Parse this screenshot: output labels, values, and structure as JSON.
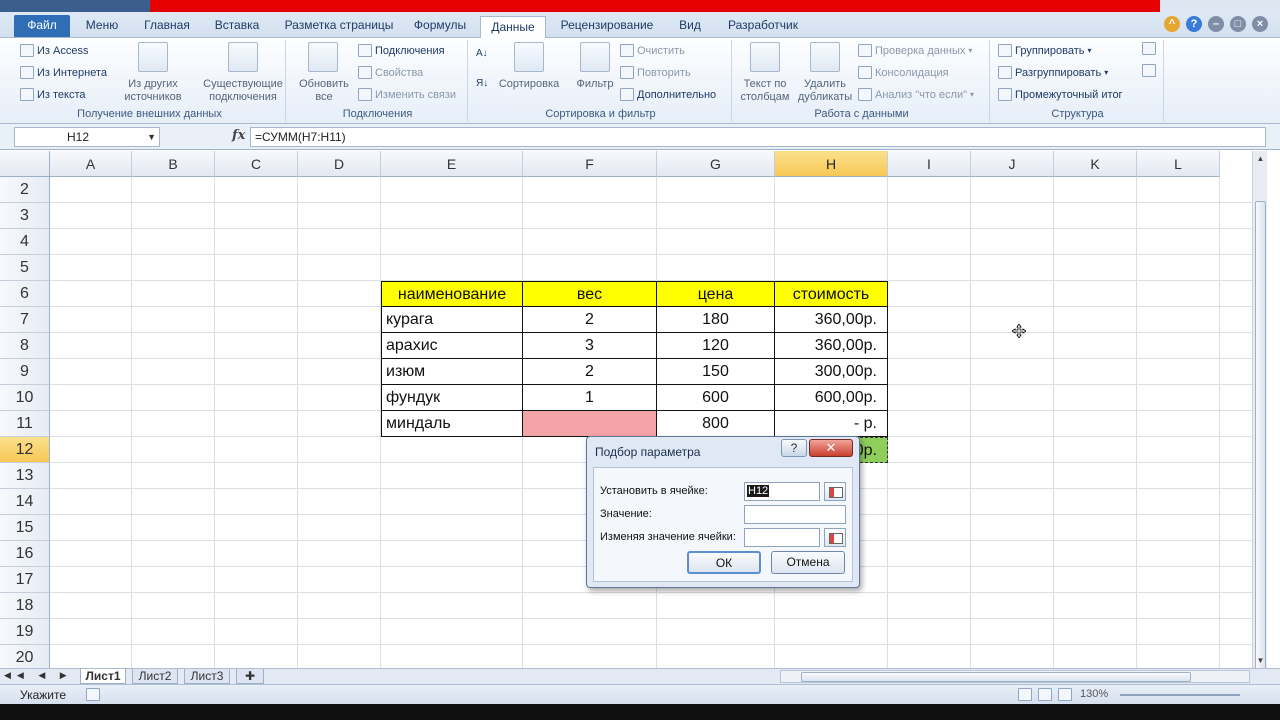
{
  "ribbon_tabs": [
    {
      "label": "Файл"
    },
    {
      "label": "Меню"
    },
    {
      "label": "Главная"
    },
    {
      "label": "Вставка"
    },
    {
      "label": "Разметка страницы"
    },
    {
      "label": "Формулы"
    },
    {
      "label": "Данные"
    },
    {
      "label": "Рецензирование"
    },
    {
      "label": "Вид"
    },
    {
      "label": "Разработчик"
    }
  ],
  "ribbon": {
    "external": {
      "from_access": "Из Access",
      "from_web": "Из Интернета",
      "from_text": "Из текста",
      "from_other_line1": "Из других",
      "from_other_line2": "источников",
      "existing_line1": "Существующие",
      "existing_line2": "подключения",
      "label": "Получение внешних данных"
    },
    "connections": {
      "refresh_line1": "Обновить",
      "refresh_line2": "все",
      "connections": "Подключения",
      "properties": "Свойства",
      "edit_links": "Изменить связи",
      "label": "Подключения"
    },
    "sort_filter": {
      "sort": "Сортировка",
      "filter": "Фильтр",
      "clear": "Очистить",
      "reapply": "Повторить",
      "advanced": "Дополнительно",
      "label": "Сортировка и фильтр"
    },
    "data_tools": {
      "text_to_cols_line1": "Текст по",
      "text_to_cols_line2": "столбцам",
      "remove_dups_line1": "Удалить",
      "remove_dups_line2": "дубликаты",
      "validation": "Проверка данных",
      "consolidation": "Консолидация",
      "whatif": "Анализ \"что если\"",
      "label": "Работа с данными"
    },
    "outline": {
      "group": "Группировать",
      "ungroup": "Разгруппировать",
      "subtotal": "Промежуточный итог",
      "label": "Структура"
    }
  },
  "formula_bar": {
    "name_box": "H12",
    "fx": "fx",
    "formula": "=СУММ(H7:H11)"
  },
  "columns": [
    "A",
    "B",
    "C",
    "D",
    "E",
    "F",
    "G",
    "H",
    "I",
    "J",
    "K",
    "L"
  ],
  "rows": [
    "2",
    "3",
    "4",
    "5",
    "6",
    "7",
    "8",
    "9",
    "10",
    "11",
    "12",
    "13",
    "14",
    "15",
    "16",
    "17",
    "18",
    "19",
    "20"
  ],
  "table": {
    "headers": [
      "наименование",
      "вес",
      "цена",
      "стоимость"
    ],
    "rows": [
      [
        "курага",
        "2",
        "180",
        "360,00р."
      ],
      [
        "арахис",
        "3",
        "120",
        "360,00р."
      ],
      [
        "изюм",
        "2",
        "150",
        "300,00р."
      ],
      [
        "фундук",
        "1",
        "600",
        "600,00р."
      ],
      [
        "миндаль",
        "",
        "800",
        "-    р."
      ]
    ],
    "total_visible": "0р."
  },
  "dialog": {
    "title": "Подбор параметра",
    "help": "?",
    "close": "✕",
    "set_cell_label": "Установить в ячейке:",
    "set_cell_value": "H12",
    "to_value_label": "Значение:",
    "to_value_value": "",
    "by_changing_label": "Изменяя значение ячейки:",
    "by_changing_value": "",
    "ok": "ОК",
    "cancel": "Отмена"
  },
  "sheets": [
    {
      "label": "Лист1"
    },
    {
      "label": "Лист2"
    },
    {
      "label": "Лист3"
    }
  ],
  "status": {
    "mode": "Укажите",
    "zoom": "130%"
  },
  "colors": {
    "header_fill": "#ffff00",
    "pink_fill": "#f4a3a6",
    "green_fill": "#8fce5b",
    "selected_header": "#f7c857",
    "file_tab": "#2f6db5"
  }
}
